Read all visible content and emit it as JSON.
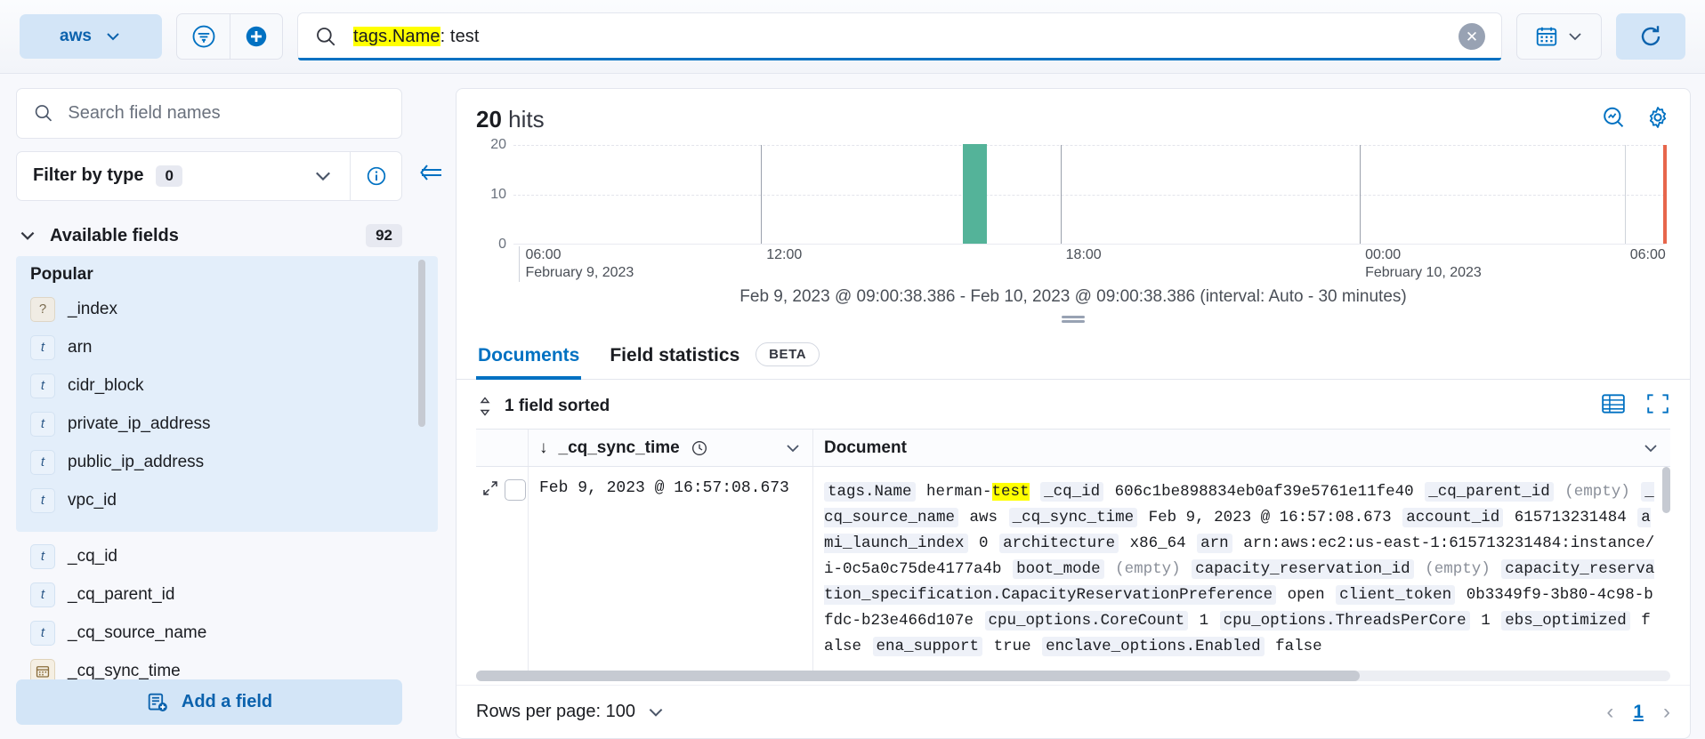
{
  "topbar": {
    "datasource_label": "aws",
    "filter_icon": "filter-icon",
    "add_filter_icon": "plus-circle-icon",
    "search_icon": "search-icon",
    "query_highlight": "tags.Name",
    "query_rest": ": test",
    "clear_icon": "clear-circle-icon",
    "date_icon": "calendar-icon",
    "refresh_icon": "refresh-icon"
  },
  "sidebar": {
    "search_placeholder": "Search field names",
    "search_value": "",
    "search_icon": "search-icon",
    "collapse_icon": "collapse-sidebar-icon",
    "filter_label": "Filter by type",
    "filter_count": "0",
    "filter_info_icon": "info-circle-icon",
    "available_label": "Available fields",
    "available_count": "92",
    "popular_label": "Popular",
    "popular_fields": [
      {
        "name": "_index",
        "type": "q"
      },
      {
        "name": "arn",
        "type": "t"
      },
      {
        "name": "cidr_block",
        "type": "t"
      },
      {
        "name": "private_ip_address",
        "type": "t"
      },
      {
        "name": "public_ip_address",
        "type": "t"
      },
      {
        "name": "vpc_id",
        "type": "t"
      }
    ],
    "other_fields": [
      {
        "name": "_cq_id",
        "type": "t"
      },
      {
        "name": "_cq_parent_id",
        "type": "t"
      },
      {
        "name": "_cq_source_name",
        "type": "t"
      },
      {
        "name": "_cq_sync_time",
        "type": "d"
      }
    ],
    "add_field_label": "Add a field",
    "add_field_icon": "add-field-icon"
  },
  "main": {
    "hits_count": "20",
    "hits_label": "hits",
    "visualize_icon": "visualize-magnifier-icon",
    "settings_icon": "gear-icon",
    "range_caption": "Feb 9, 2023 @ 09:00:38.386 - Feb 10, 2023 @ 09:00:38.386 (interval: Auto - 30 minutes)",
    "resize_handle_icon": "resize-handle-icon",
    "tabs": [
      {
        "label": "Documents",
        "active": true,
        "badge": ""
      },
      {
        "label": "Field statistics",
        "active": false,
        "badge": "BETA"
      }
    ],
    "sorted_label": "1 field sorted",
    "sort_icon": "sort-updown-icon",
    "density_icon": "display-options-icon",
    "fullscreen_icon": "fullscreen-icon",
    "columns": {
      "sort_arrow": "↓",
      "time_column": "_cq_sync_time",
      "time_column_icon": "clock-icon",
      "document_column": "Document",
      "chevron_icon": "chevron-down-icon"
    },
    "row": {
      "expand_icon": "expand-row-icon",
      "checkbox": "row-select-checkbox",
      "timestamp": "Feb 9, 2023 @ 16:57:08.673",
      "document_tokens": [
        {
          "k": "tags.Name",
          "v": "herman-",
          "hl": "test"
        },
        {
          "k": "_cq_id",
          "v": "606c1be898834eb0af39e5761e11fe40"
        },
        {
          "k": "_cq_parent_id",
          "v": "(empty)",
          "empty": true
        },
        {
          "k": "_cq_source_name",
          "v": "aws"
        },
        {
          "k": "_cq_sync_time",
          "v": "Feb 9, 2023 @ 16:57:08.673"
        },
        {
          "k": "account_id",
          "v": "615713231484"
        },
        {
          "k": "ami_launch_index",
          "v": "0"
        },
        {
          "k": "architecture",
          "v": "x86_64"
        },
        {
          "k": "arn",
          "v": "arn:aws:ec2:us-east-1:615713231484:instance/i-0c5a0c75de4177a4b"
        },
        {
          "k": "boot_mode",
          "v": "(empty)",
          "empty": true
        },
        {
          "k": "capacity_reservation_id",
          "v": "(empty)",
          "empty": true
        },
        {
          "k": "capacity_reservation_specification.CapacityReservationPreference",
          "v": "open"
        },
        {
          "k": "client_token",
          "v": "0b3349f9-3b80-4c98-bfdc-b23e466d107e"
        },
        {
          "k": "cpu_options.CoreCount",
          "v": "1"
        },
        {
          "k": "cpu_options.ThreadsPerCore",
          "v": "1"
        },
        {
          "k": "ebs_optimized",
          "v": "false"
        },
        {
          "k": "ena_support",
          "v": "true"
        },
        {
          "k": "enclave_options.Enabled",
          "v": "false"
        }
      ]
    },
    "footer": {
      "rows_per_page_label": "Rows per page: 100",
      "rows_per_page_chevron": "chevron-down-icon",
      "prev_icon": "chevron-left-icon",
      "next_icon": "chevron-right-icon",
      "current_page": "1"
    }
  },
  "chart_data": {
    "type": "bar",
    "title": "",
    "xlabel": "",
    "ylabel": "",
    "ylim": [
      0,
      20
    ],
    "yticks": [
      "0",
      "10",
      "20"
    ],
    "xticks": [
      {
        "time": "06:00",
        "date": "February 9, 2023",
        "pos": 0.02
      },
      {
        "time": "12:00",
        "date": "",
        "pos": 0.215
      },
      {
        "time": "18:00",
        "date": "",
        "pos": 0.475
      },
      {
        "time": "00:00",
        "date": "February 10, 2023",
        "pos": 0.735
      },
      {
        "time": "06:00",
        "date": "",
        "pos": 0.965
      }
    ],
    "bars": [
      {
        "label": "Feb 9, 2023 16:30",
        "value": 20,
        "pos": 0.39,
        "color": "#54b399"
      }
    ],
    "end_marker": {
      "pos": 1.0,
      "color": "#e7664c"
    },
    "grid": true,
    "legend": false,
    "interval": "Auto - 30 minutes",
    "total_hits": 20
  },
  "colors": {
    "accent": "#0071c2",
    "bar": "#54b399",
    "end_marker": "#e7664c",
    "highlight": "#ffff00",
    "popular_bg": "#e3eefa"
  }
}
